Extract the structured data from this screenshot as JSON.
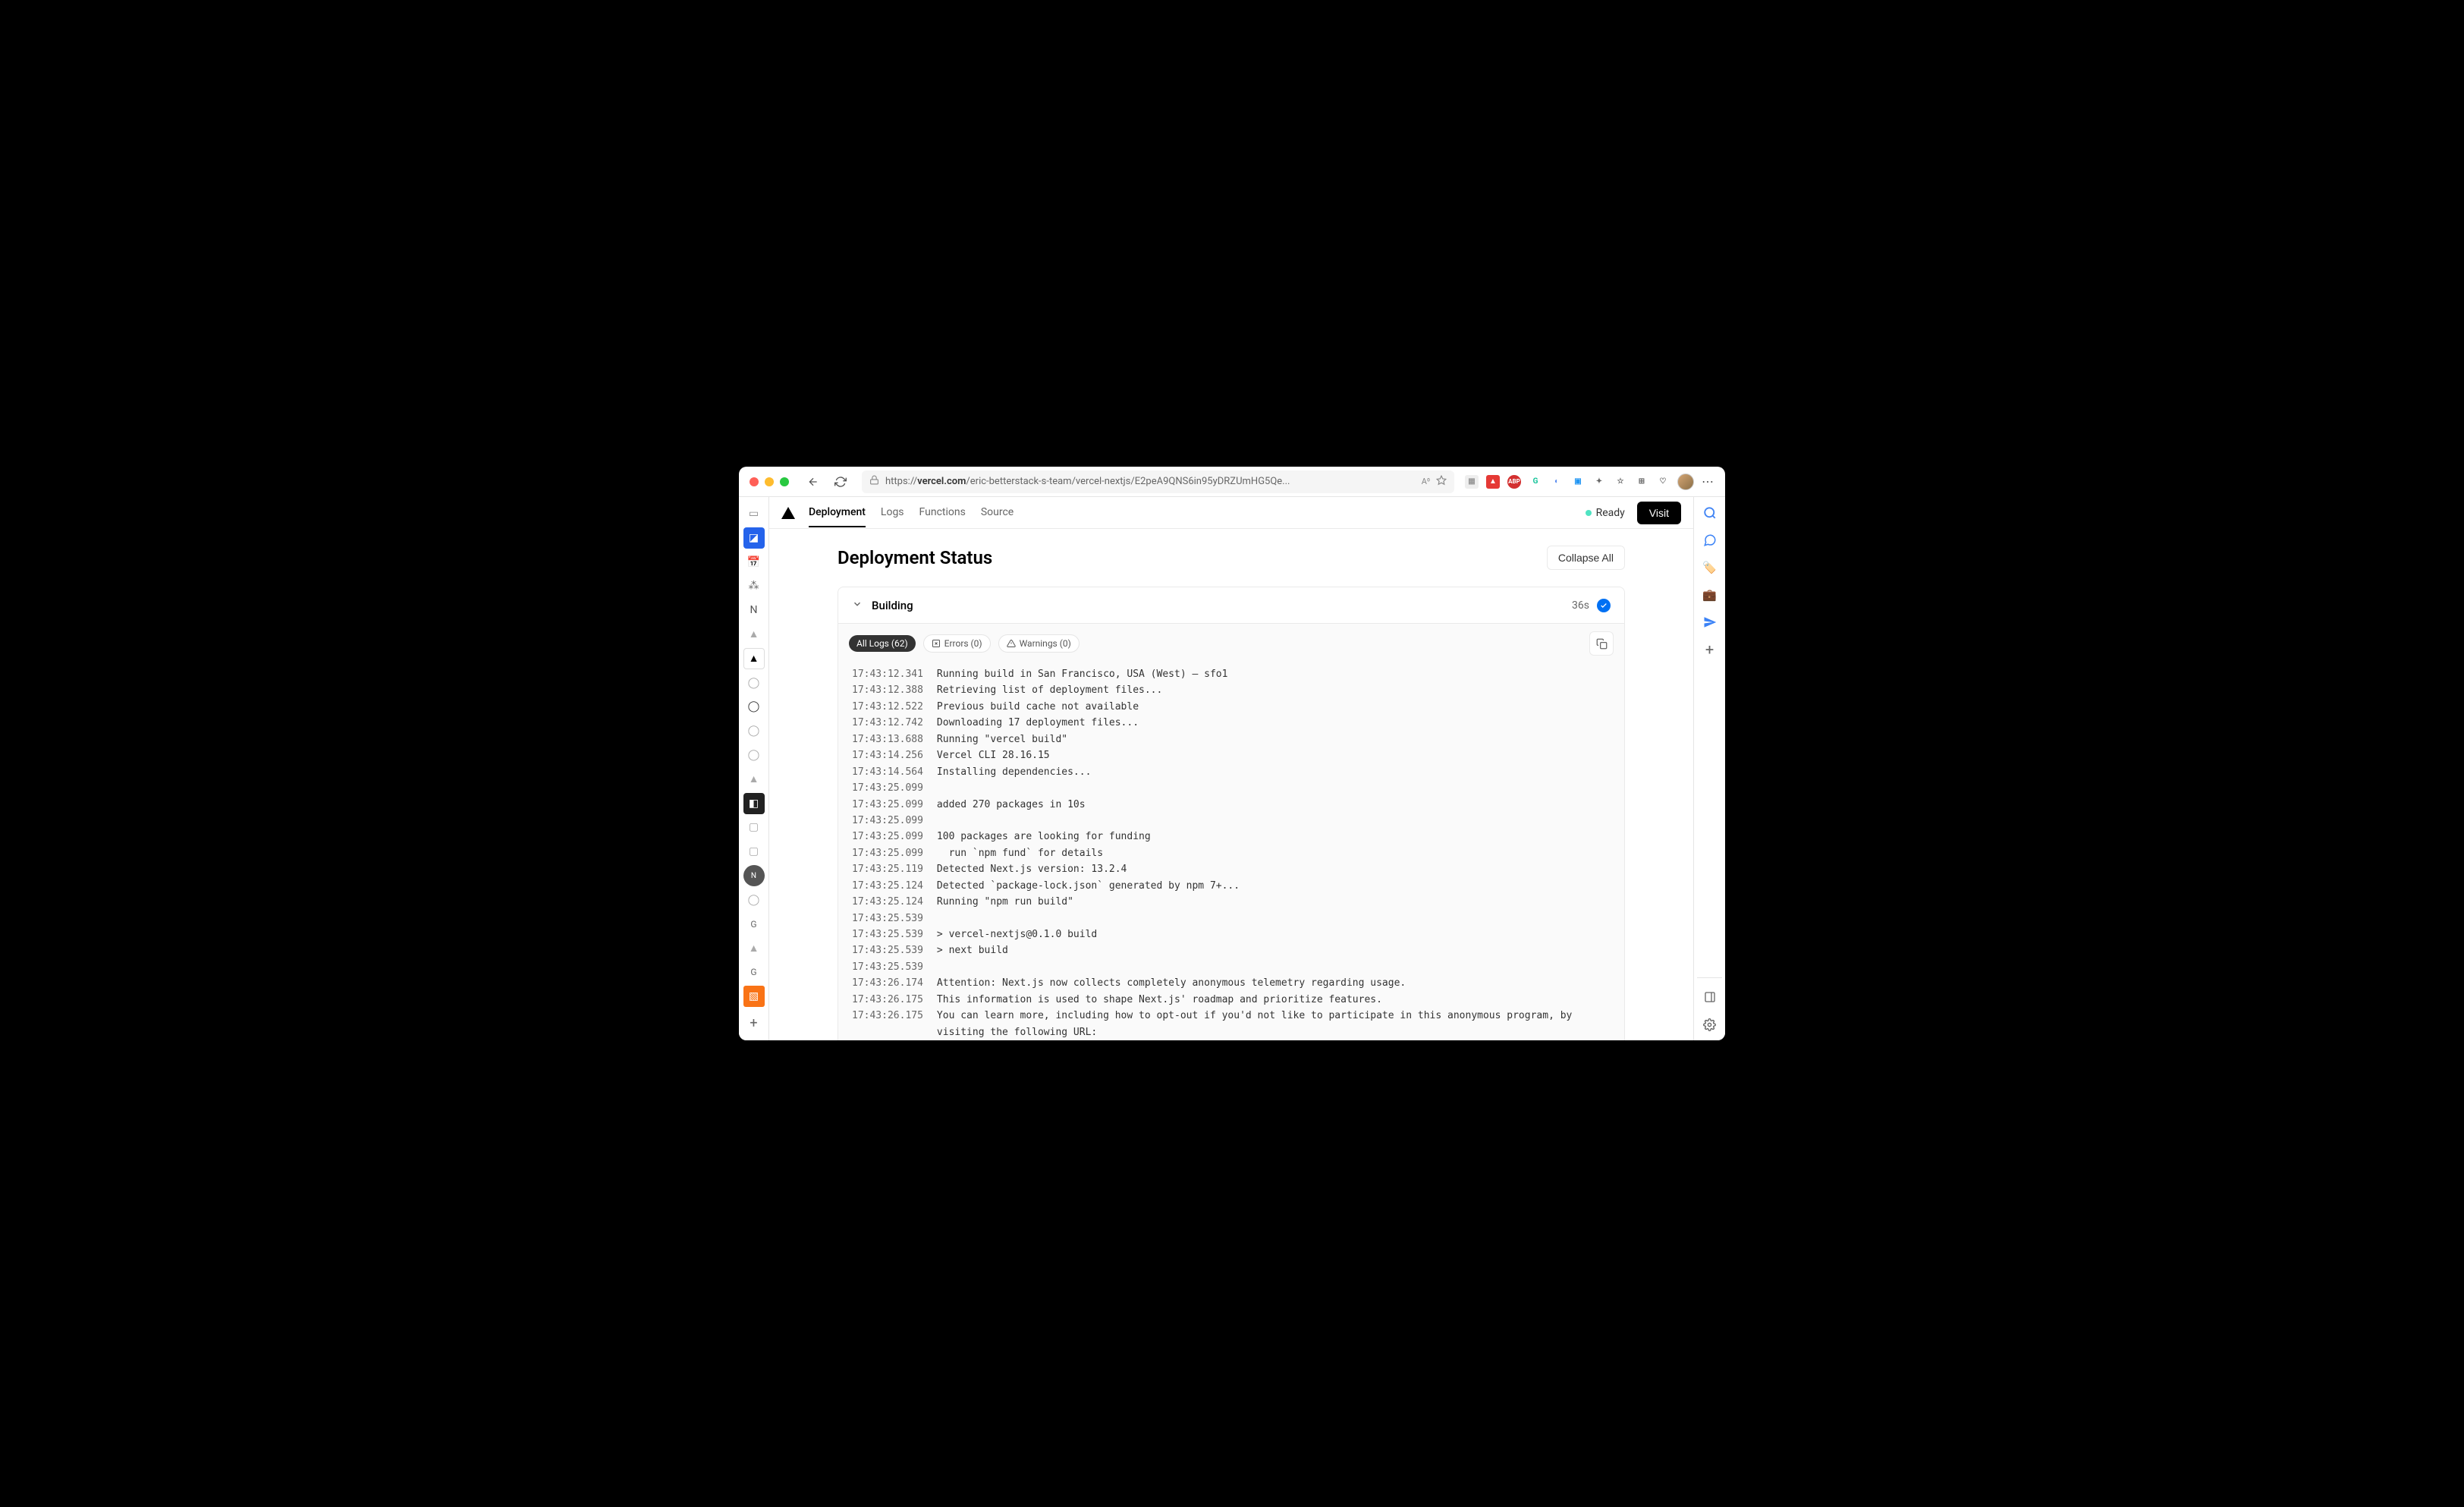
{
  "browser": {
    "url_prefix": "https://",
    "url_host": "vercel.com",
    "url_path": "/eric-betterstack-s-team/vercel-nextjs/E2peA9QNS6in95yDRZUmHG5Qe..."
  },
  "header": {
    "tabs": [
      "Deployment",
      "Logs",
      "Functions",
      "Source"
    ],
    "status": "Ready",
    "visit": "Visit"
  },
  "page": {
    "title": "Deployment Status",
    "collapse": "Collapse All"
  },
  "panel": {
    "title": "Building",
    "duration": "36s"
  },
  "filters": {
    "all": "All Logs (62)",
    "errors": "Errors (0)",
    "warnings": "Warnings (0)"
  },
  "logs": [
    {
      "ts": "17:43:12.341",
      "msg": "Running build in San Francisco, USA (West) – sfo1"
    },
    {
      "ts": "17:43:12.388",
      "msg": "Retrieving list of deployment files..."
    },
    {
      "ts": "17:43:12.522",
      "msg": "Previous build cache not available"
    },
    {
      "ts": "17:43:12.742",
      "msg": "Downloading 17 deployment files..."
    },
    {
      "ts": "17:43:13.688",
      "msg": "Running \"vercel build\""
    },
    {
      "ts": "17:43:14.256",
      "msg": "Vercel CLI 28.16.15"
    },
    {
      "ts": "17:43:14.564",
      "msg": "Installing dependencies..."
    },
    {
      "ts": "17:43:25.099",
      "msg": ""
    },
    {
      "ts": "17:43:25.099",
      "msg": "added 270 packages in 10s"
    },
    {
      "ts": "17:43:25.099",
      "msg": ""
    },
    {
      "ts": "17:43:25.099",
      "msg": "100 packages are looking for funding"
    },
    {
      "ts": "17:43:25.099",
      "msg": "  run `npm fund` for details"
    },
    {
      "ts": "17:43:25.119",
      "msg": "Detected Next.js version: 13.2.4"
    },
    {
      "ts": "17:43:25.124",
      "msg": "Detected `package-lock.json` generated by npm 7+..."
    },
    {
      "ts": "17:43:25.124",
      "msg": "Running \"npm run build\""
    },
    {
      "ts": "17:43:25.539",
      "msg": ""
    },
    {
      "ts": "17:43:25.539",
      "msg": "> vercel-nextjs@0.1.0 build"
    },
    {
      "ts": "17:43:25.539",
      "msg": "> next build"
    },
    {
      "ts": "17:43:25.539",
      "msg": ""
    },
    {
      "ts": "17:43:26.174",
      "msg": "Attention: Next.js now collects completely anonymous telemetry regarding usage."
    },
    {
      "ts": "17:43:26.175",
      "msg": "This information is used to shape Next.js' roadmap and prioritize features."
    },
    {
      "ts": "17:43:26.175",
      "msg": "You can learn more, including how to opt-out if you'd not like to participate in this anonymous program, by visiting the following URL:"
    }
  ]
}
